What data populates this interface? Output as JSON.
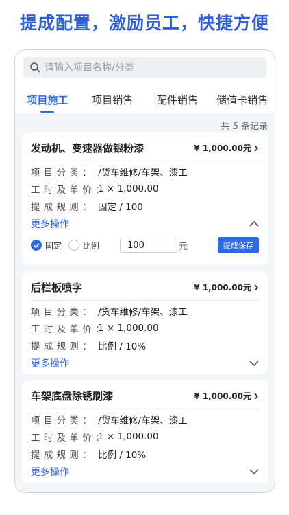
{
  "headline": "提成配置，激励员工，快捷方便",
  "search": {
    "placeholder": "请输入项目名称/分类"
  },
  "tabs": [
    {
      "label": "项目施工",
      "active": true
    },
    {
      "label": "项目销售",
      "active": false
    },
    {
      "label": "配件销售",
      "active": false
    },
    {
      "label": "储值卡销售",
      "active": false
    }
  ],
  "record_count": "共 5 条记录",
  "labels": {
    "category": "项 目 分 类 ：",
    "hours_price": "工 时 及 单 价 ：",
    "rule": "提 成 规 则 ：",
    "more": "更多操作"
  },
  "items": [
    {
      "name": "发动机、变速器做银粉漆",
      "price": "¥ 1,000.00元",
      "category": "/货车维修/车架、漆工",
      "hours_price": "1 × 1,000.00",
      "rule": "固定 / 100",
      "expanded": true
    },
    {
      "name": "后栏板喷字",
      "price": "¥ 1,000.00元",
      "category": "/货车维修/车架、漆工",
      "hours_price": "1 × 1,000.00",
      "rule": "比例 / 10%",
      "expanded": false
    },
    {
      "name": "车架底盘除锈刷漆",
      "price": "¥ 1,000.00元",
      "category": "/货车维修/车架、漆工",
      "hours_price": "1 × 1,000.00",
      "rule": "比例 / 10%",
      "expanded": false
    }
  ],
  "editor": {
    "fixed_label": "固定",
    "ratio_label": "比例",
    "selected": "固定",
    "value": "100",
    "unit": "元",
    "save_label": "提成保存"
  },
  "colors": {
    "accent": "#2f6be0",
    "headline": "#2f5fdc"
  }
}
